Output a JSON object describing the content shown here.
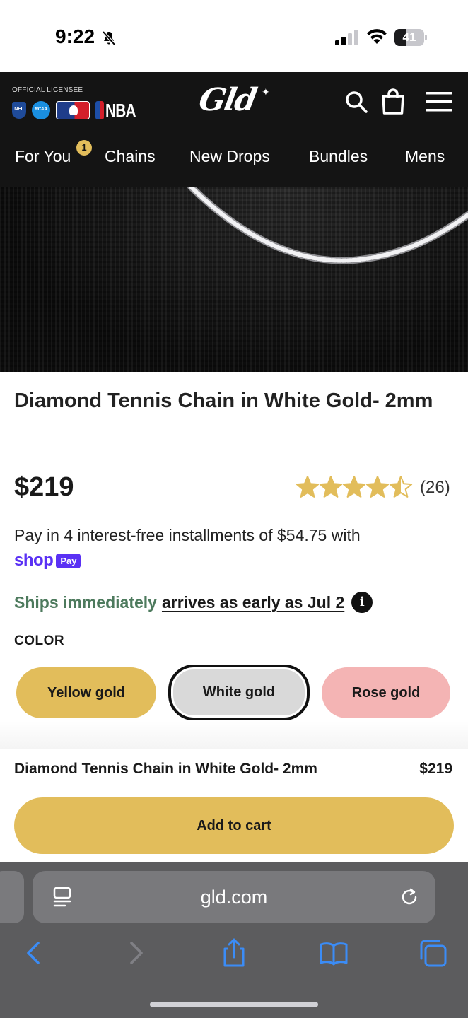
{
  "status_bar": {
    "time": "9:22",
    "battery": "41",
    "battery_level": 0.41
  },
  "header": {
    "licensee_label": "OFFICIAL LICENSEE",
    "league_logos": [
      "NFL",
      "NCAA",
      "MLB",
      "NBA"
    ],
    "nba_text": "NBA",
    "brand": "Gld",
    "icons": [
      "search-icon",
      "bag-icon",
      "menu-icon"
    ],
    "nav": [
      {
        "label": "For You",
        "badge": "1"
      },
      {
        "label": "Chains"
      },
      {
        "label": "New Drops"
      },
      {
        "label": "Bundles"
      },
      {
        "label": "Mens"
      }
    ]
  },
  "product": {
    "title": "Diamond Tennis Chain in White Gold- 2mm",
    "price": "$219",
    "rating": 4.5,
    "review_count": "(26)",
    "installments": "Pay in 4 interest-free installments of $54.75 with",
    "shop_pay": {
      "shop": "shop",
      "pay": "Pay"
    },
    "ships": "Ships immediately",
    "arrives": "arrives as early as Jul 2",
    "info_glyph": "i",
    "color_label": "COLOR",
    "colors": [
      {
        "label": "Yellow gold",
        "hex": "#e2bd5b",
        "selected": false
      },
      {
        "label": "White gold",
        "hex": "#d9d9d9",
        "selected": true
      },
      {
        "label": "Rose gold",
        "hex": "#f4b4b4",
        "selected": false
      }
    ]
  },
  "sticky": {
    "title": "Diamond Tennis Chain in White Gold- 2mm",
    "price": "$219",
    "add_to_cart": "Add to cart"
  },
  "browser": {
    "url": "gld.com",
    "toolbar": [
      "back-icon",
      "forward-icon",
      "share-icon",
      "bookmarks-icon",
      "tabs-icon"
    ]
  },
  "colors": {
    "accent_gold": "#e2bd5b",
    "header_bg": "#141414",
    "ships_green": "#4d7a5d",
    "shop_pay_purple": "#5a31f4",
    "ios_blue": "#3b8cf6"
  }
}
